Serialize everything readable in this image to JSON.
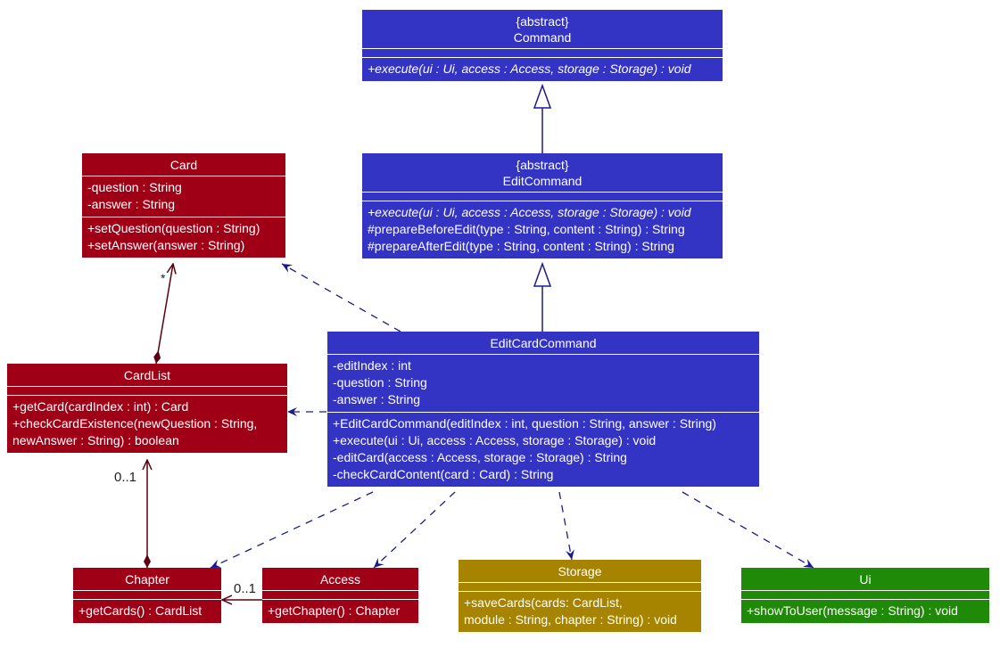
{
  "colors": {
    "command_fill": "#3333c4",
    "model_fill": "#a00015",
    "storage_fill": "#a78400",
    "ui_fill": "#1f8a08",
    "dependency_line": "#1a1a8c",
    "composition_line": "#5a0010"
  },
  "classes": {
    "command": {
      "stereotype": "{abstract}",
      "name": "Command",
      "attributes": [],
      "methods": [
        {
          "text": "+execute(ui : Ui, access : Access, storage : Storage) : void",
          "abstract": true
        }
      ]
    },
    "editCommand": {
      "stereotype": "{abstract}",
      "name": "EditCommand",
      "attributes": [],
      "methods": [
        {
          "text": "+execute(ui : Ui, access : Access, storage : Storage) : void",
          "abstract": true
        },
        {
          "text": "#prepareBeforeEdit(type : String, content : String) : String",
          "abstract": false
        },
        {
          "text": "#prepareAfterEdit(type : String, content : String) : String",
          "abstract": false
        }
      ]
    },
    "editCardCommand": {
      "name": "EditCardCommand",
      "attributes": [
        "-editIndex : int",
        "-question : String",
        "-answer : String"
      ],
      "methods": [
        "+EditCardCommand(editIndex : int, question : String, answer : String)",
        "+execute(ui : Ui, access : Access, storage : Storage) : void",
        "-editCard(access : Access, storage : Storage) : String",
        "-checkCardContent(card : Card) : String"
      ]
    },
    "card": {
      "name": "Card",
      "attributes": [
        "-question : String",
        "-answer : String"
      ],
      "methods": [
        "+setQuestion(question : String)",
        "+setAnswer(answer : String)"
      ]
    },
    "cardList": {
      "name": "CardList",
      "attributes": [],
      "methods": [
        "+getCard(cardIndex : int) : Card",
        "+checkCardExistence(newQuestion : String,",
        "newAnswer : String) : boolean"
      ]
    },
    "chapter": {
      "name": "Chapter",
      "attributes": [],
      "methods": [
        "+getCards() : CardList"
      ]
    },
    "access": {
      "name": "Access",
      "attributes": [],
      "methods": [
        "+getChapter() : Chapter"
      ]
    },
    "storage": {
      "name": "Storage",
      "attributes": [],
      "methods": [
        "+saveCards(cards: CardList,",
        "module : String, chapter : String) : void"
      ]
    },
    "ui": {
      "name": "Ui",
      "attributes": [],
      "methods": [
        "+showToUser(message : String) : void"
      ]
    }
  },
  "relationships": [
    {
      "type": "generalization",
      "from": "EditCommand",
      "to": "Command"
    },
    {
      "type": "generalization",
      "from": "EditCardCommand",
      "to": "EditCommand"
    },
    {
      "type": "dependency",
      "from": "EditCardCommand",
      "to": "Card"
    },
    {
      "type": "dependency",
      "from": "EditCardCommand",
      "to": "CardList"
    },
    {
      "type": "dependency",
      "from": "EditCardCommand",
      "to": "Chapter"
    },
    {
      "type": "dependency",
      "from": "EditCardCommand",
      "to": "Access"
    },
    {
      "type": "dependency",
      "from": "EditCardCommand",
      "to": "Storage"
    },
    {
      "type": "dependency",
      "from": "EditCardCommand",
      "to": "Ui"
    },
    {
      "type": "composition",
      "from": "CardList",
      "to": "Card",
      "multiplicity": "*"
    },
    {
      "type": "composition",
      "from": "Chapter",
      "to": "CardList",
      "multiplicity": "0..1"
    },
    {
      "type": "association",
      "from": "Access",
      "to": "Chapter",
      "multiplicity": "0..1"
    }
  ],
  "labels": {
    "card_multiplicity": "*",
    "cardlist_multiplicity": "0..1",
    "chapter_multiplicity": "0..1"
  }
}
